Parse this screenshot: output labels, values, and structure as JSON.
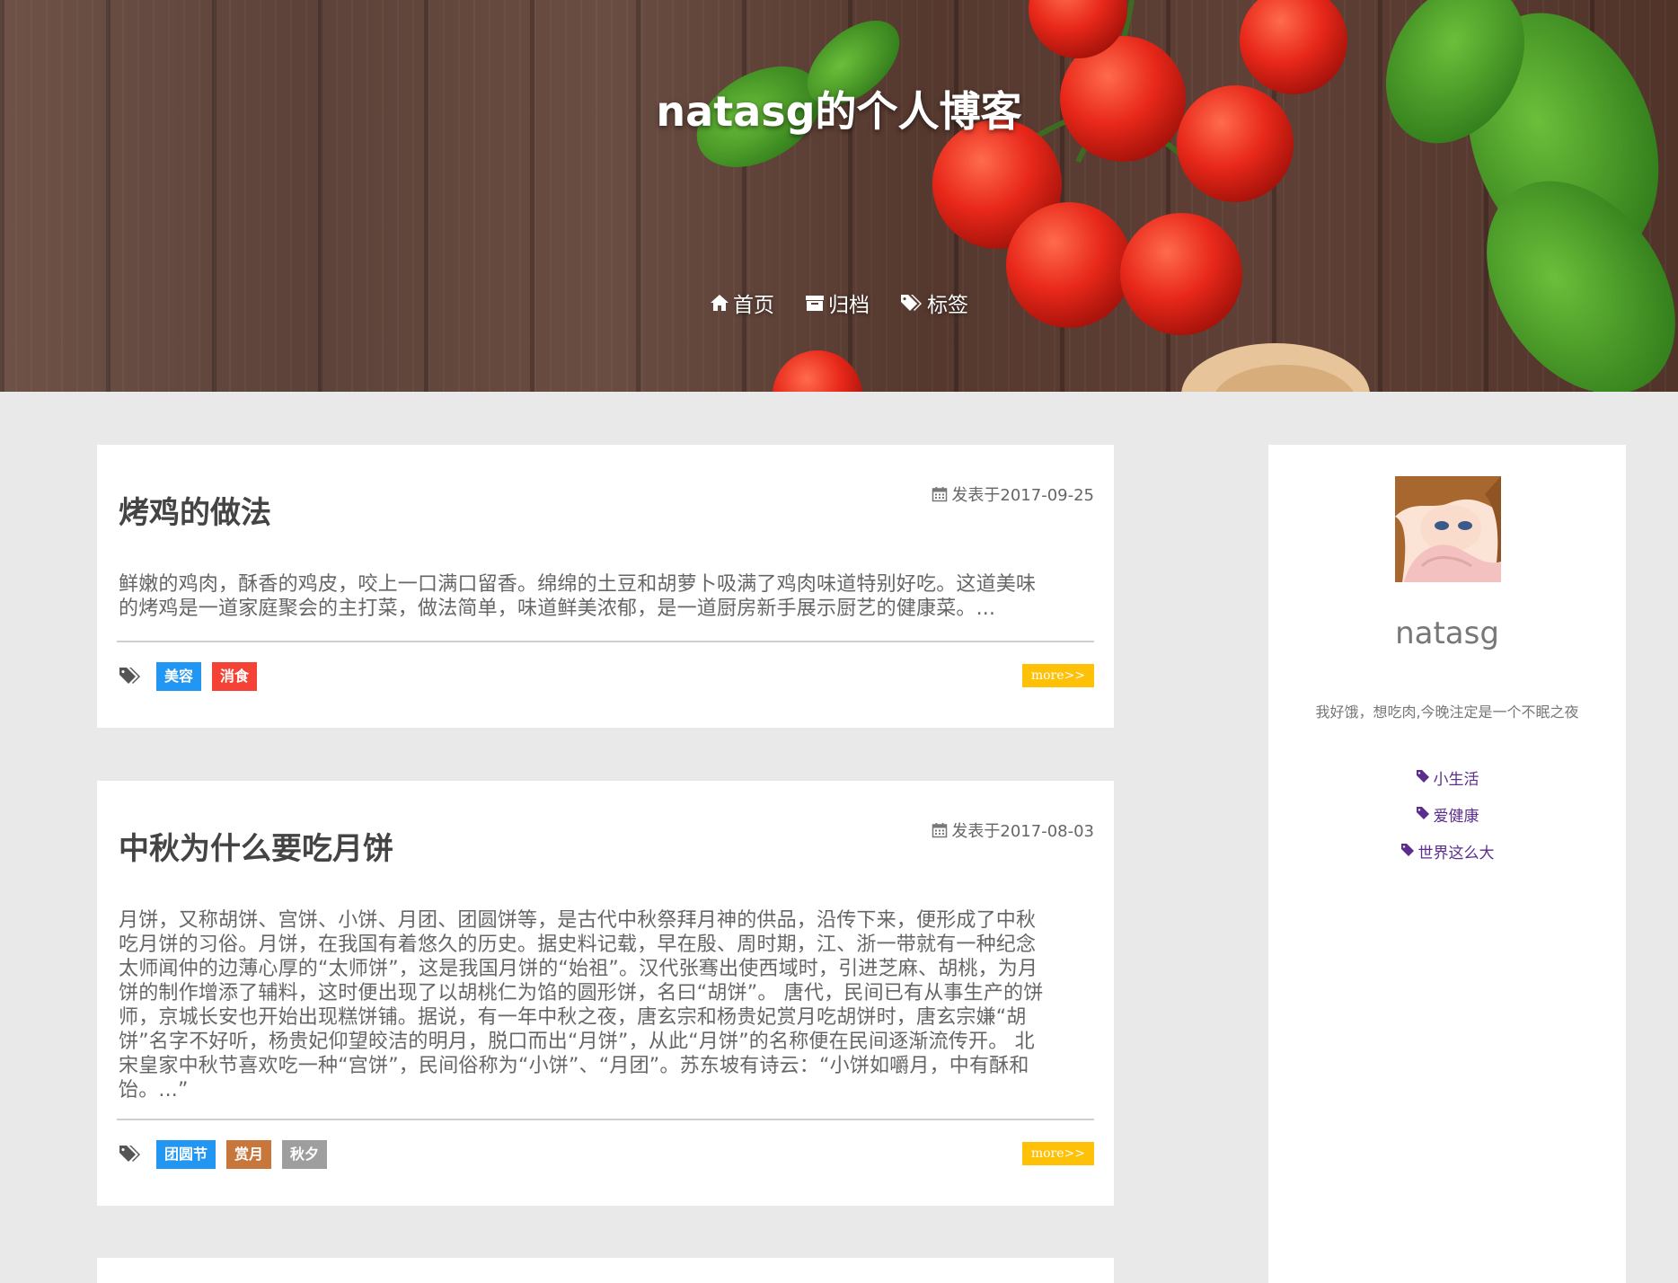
{
  "site": {
    "title": "natasg的个人博客"
  },
  "nav": {
    "items": [
      {
        "label": "首页",
        "icon": "home-icon"
      },
      {
        "label": "归档",
        "icon": "archive-icon"
      },
      {
        "label": "标签",
        "icon": "tags-icon"
      }
    ]
  },
  "posts": [
    {
      "title": "烤鸡的做法",
      "date": "发表于2017-09-25",
      "excerpt_lines": [
        "鲜嫩的鸡肉，酥香的鸡皮，咬上一口满口留香。绵绵的土豆和胡萝卜吸满了鸡肉味道特别好吃。这道美味",
        "的烤鸡是一道家庭聚会的主打菜，做法简单，味道鲜美浓郁，是一道厨房新手展示厨艺的健康菜。..."
      ],
      "tags": [
        {
          "label": "美容",
          "color": "#2196f3"
        },
        {
          "label": "消食",
          "color": "#f44336"
        }
      ],
      "more_label": "more>>"
    },
    {
      "title": "中秋为什么要吃月饼",
      "date": "发表于2017-08-03",
      "excerpt_lines": [
        "月饼，又称胡饼、宫饼、小饼、月团、团圆饼等，是古代中秋祭拜月神的供品，沿传下来，便形成了中秋",
        "吃月饼的习俗。月饼，在我国有着悠久的历史。据史料记载，早在殷、周时期，江、浙一带就有一种纪念",
        "太师闻仲的边薄心厚的“太师饼”，这是我国月饼的“始祖”。汉代张骞出使西域时，引进芝麻、胡桃，为月",
        "饼的制作增添了辅料，这时便出现了以胡桃仁为馅的圆形饼，名曰“胡饼”。 唐代，民间已有从事生产的饼",
        "师，京城长安也开始出现糕饼铺。据说，有一年中秋之夜，唐玄宗和杨贵妃赏月吃胡饼时，唐玄宗嫌“胡",
        "饼”名字不好听，杨贵妃仰望皎洁的明月，脱口而出“月饼”，从此“月饼”的名称便在民间逐渐流传开。 北",
        "宋皇家中秋节喜欢吃一种“宫饼”，民间俗称为“小饼”、“月团”。苏东坡有诗云：“小饼如嚼月，中有酥和",
        "饴。...”"
      ],
      "tags": [
        {
          "label": "团圆节",
          "color": "#2196f3"
        },
        {
          "label": "赏月",
          "color": "#c8773c"
        },
        {
          "label": "秋夕",
          "color": "#9e9e9e"
        }
      ],
      "more_label": "more>>"
    }
  ],
  "sidebar": {
    "author": "natasg",
    "bio": "我好饿，想吃肉,今晚注定是一个不眠之夜",
    "categories": [
      {
        "label": "小生活"
      },
      {
        "label": "爱健康"
      },
      {
        "label": "世界这么大"
      }
    ],
    "link_color": "#5b2e8e"
  }
}
